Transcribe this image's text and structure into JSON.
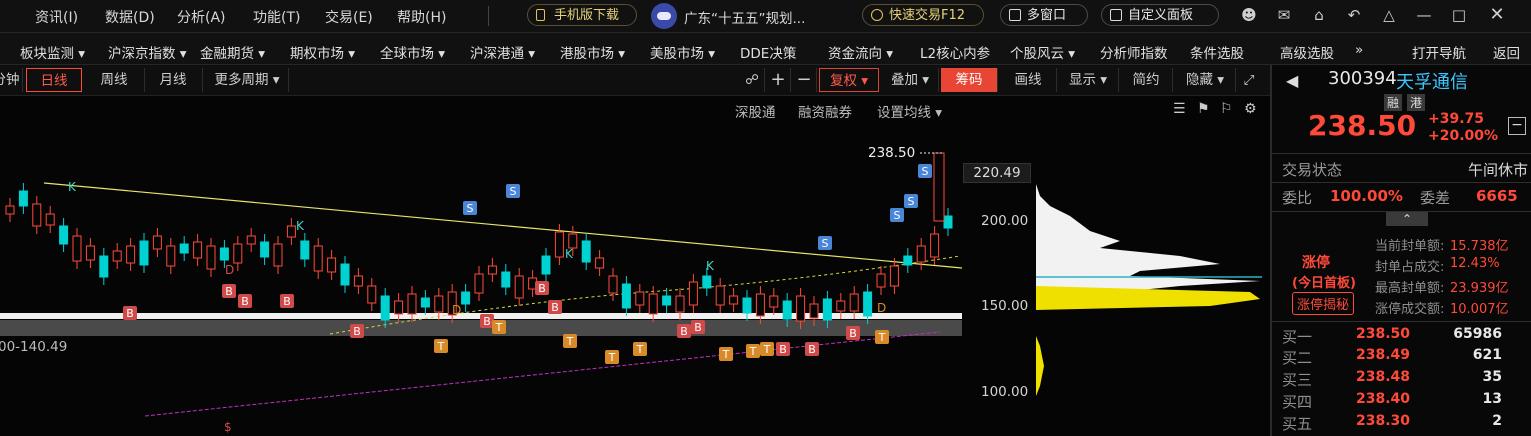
{
  "menu": [
    "资讯(I)",
    "数据(D)",
    "分析(A)",
    "功能(T)",
    "交易(E)",
    "帮助(H)"
  ],
  "top_buttons": {
    "mobile_download": "手机版下载",
    "news_headline": "广东“十五五”规划...",
    "quick_trade": "快速交易F12",
    "multi_window": "多窗口",
    "custom_panel": "自定义面板"
  },
  "nav": [
    "板块监测 ▾",
    "沪深京指数 ▾",
    "金融期货 ▾",
    "期权市场 ▾",
    "全球市场 ▾",
    "沪深港通 ▾",
    "港股市场 ▾",
    "美股市场 ▾",
    "DDE决策",
    "资金流向 ▾",
    "L2核心内参",
    "个股风云 ▾",
    "分析师指数",
    "条件选股",
    "高级选股",
    "»",
    "打开导航",
    "返回"
  ],
  "chart_toolbar": {
    "tabs": [
      "分钟",
      "日线",
      "周线",
      "月线",
      "更多周期 ▾"
    ],
    "active_tab": "日线",
    "adjust": "复权 ▾",
    "overlay": "叠加 ▾",
    "chips": "筹码",
    "draw": "画线",
    "display": "显示 ▾",
    "simple": "简约",
    "hide": "隐藏 ▾"
  },
  "chart_links": [
    "深股通",
    "融资融券",
    "设置均线 ▾"
  ],
  "chart_data": {
    "type": "candlestick",
    "last_price_label": "238.50",
    "price_axis_labels": [
      "220.49",
      "200.00",
      "150.00",
      "100.00"
    ],
    "range_label": "00-140.49",
    "colors": {
      "up": "#ff4a3a",
      "down": "#00d2d2",
      "trend_line": "#e8e870",
      "ma_dotted": "#d8d83a",
      "support": "#b030b0",
      "volume_profile": "#f5f5f5",
      "profile_yellow": "#f0e000"
    },
    "markers": [
      "K",
      "K",
      "K",
      "K",
      "S",
      "S",
      "S",
      "S",
      "S",
      "S",
      "B",
      "T",
      "D"
    ]
  },
  "stock": {
    "code": "300394",
    "name": "天孚通信",
    "tags": [
      "融",
      "港"
    ],
    "price": "238.50",
    "change": "+39.75",
    "change_pct": "+20.00%",
    "status_label": "交易状态",
    "status_value": "午间休市",
    "weibi_label": "委比",
    "weibi_value": "100.00%",
    "weicha_label": "委差",
    "weicha_value": "6665"
  },
  "limit_up": {
    "title": "涨停",
    "subtitle": "(今日首板)",
    "button": "涨停揭秘",
    "rows": [
      {
        "label": "当前封单额:",
        "value": "15.738亿"
      },
      {
        "label": "封单占成交:",
        "value": "12.43%"
      },
      {
        "label": "最高封单额:",
        "value": "23.939亿"
      },
      {
        "label": "涨停成交额:",
        "value": "10.007亿"
      }
    ]
  },
  "orderbook": [
    {
      "label": "买一",
      "price": "238.50",
      "vol": "65986"
    },
    {
      "label": "买二",
      "price": "238.49",
      "vol": "621"
    },
    {
      "label": "买三",
      "price": "238.48",
      "vol": "35"
    },
    {
      "label": "买四",
      "price": "238.40",
      "vol": "13"
    },
    {
      "label": "买五",
      "price": "238.30",
      "vol": "2"
    }
  ]
}
